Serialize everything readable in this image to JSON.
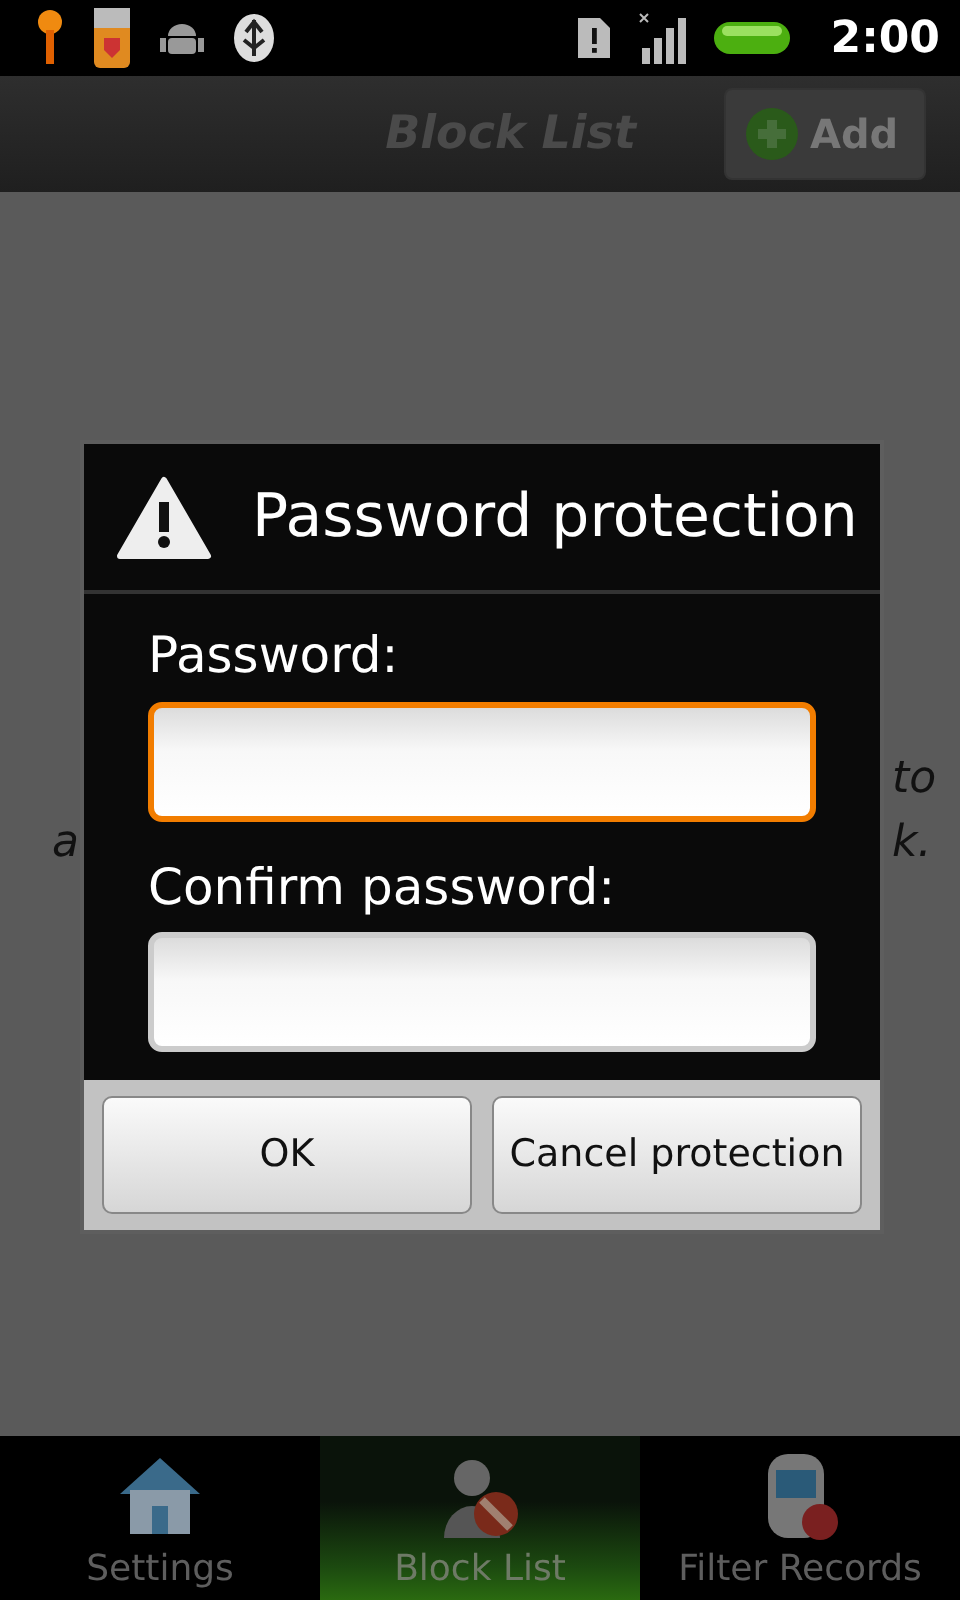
{
  "status_bar": {
    "time": "2:00"
  },
  "title_bar": {
    "title": "Block List",
    "add_button": "Add"
  },
  "hint": {
    "line_1_right": "to",
    "line_2_left": "a",
    "line_2_right": "k."
  },
  "dialog": {
    "title": "Password protection",
    "fields": [
      {
        "label": "Password:",
        "focused": true
      },
      {
        "label": "Confirm password:",
        "focused": false
      }
    ],
    "buttons": [
      "OK",
      "Cancel protection"
    ]
  },
  "tabs": [
    {
      "label": "Settings",
      "kind": "home",
      "selected": false
    },
    {
      "label": "Block List",
      "kind": "person",
      "selected": true
    },
    {
      "label": "Filter Records",
      "kind": "phone",
      "selected": false
    }
  ]
}
